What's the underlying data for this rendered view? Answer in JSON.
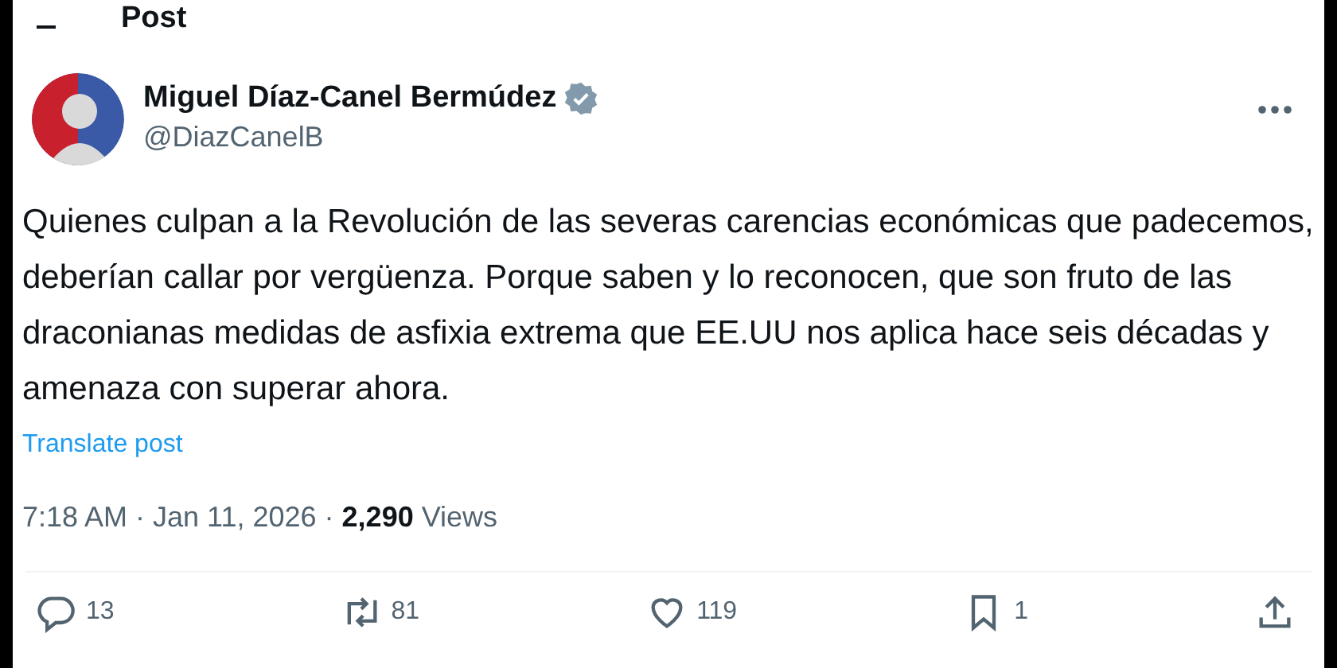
{
  "header": {
    "title": "Post"
  },
  "author": {
    "name": "Miguel Díaz-Canel Bermúdez",
    "verified": true,
    "handle": "@DiazCanelB"
  },
  "body": "Quienes culpan a la Revolución de las severas carencias económicas que padecemos, deberían callar por vergüenza. Porque saben y lo reconocen, que son fruto de las draconianas medidas de asfixia extrema que EE.UU nos aplica hace seis décadas y amenaza con superar ahora.",
  "translate_link": "Translate post",
  "meta": "7:18 AM · Jan 11, 2026 · **2,290** Views",
  "actions": [
    {
      "kind": "reply",
      "count": "13"
    },
    {
      "kind": "repost",
      "count": "81"
    },
    {
      "kind": "like",
      "count": "119"
    },
    {
      "kind": "bookmark",
      "count": "1"
    },
    {
      "kind": "share"
    }
  ]
}
